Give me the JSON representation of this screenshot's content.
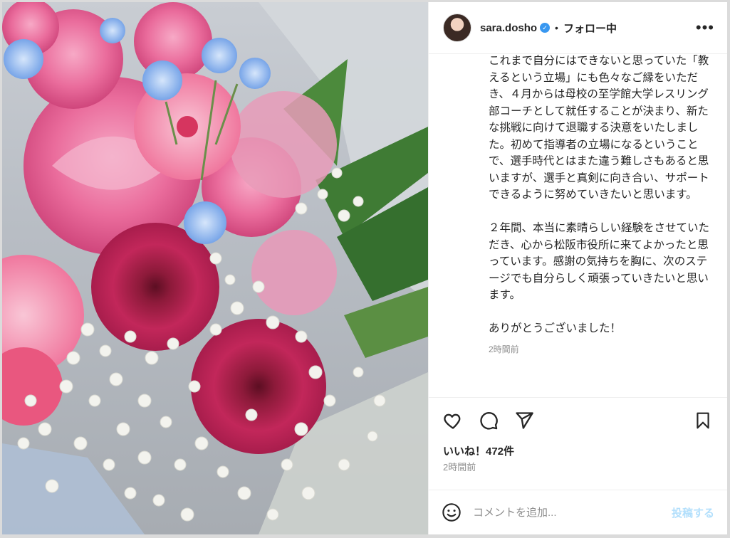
{
  "post": {
    "image_alt": "花束（ピンクのバラ、ガーベラ、青い花、かすみ草）",
    "author": {
      "username": "sara.dosho",
      "verified": true
    },
    "follow_state": "フォロー中",
    "separator": "•",
    "caption": "これまで自分にはできないと思っていた「教えるという立場」にも色々なご縁をいただき、４月からは母校の至学館大学レスリング部コーチとして就任することが決まり、新たな挑戦に向けて退職する決意をいたしました。初めて指導者の立場になるということで、選手時代とはまた違う難しさもあると思いますが、選手と真剣に向き合い、サポートできるように努めていきたいと思います。\n\n２年間、本当に素晴らしい経験をさせていただき、心から松阪市役所に来てよかったと思っています。感謝の気持ちを胸に、次のステージでも自分らしく頑張っていきたいと思います。\n\nありがとうございました！",
    "caption_time": "2時間前",
    "likes": "いいね！472件",
    "time": "2時間前"
  },
  "comment": {
    "placeholder": "コメントを追加...",
    "submit_label": "投稿する"
  },
  "icons": {
    "more": "more-options-icon",
    "like": "heart-icon",
    "comment": "comment-icon",
    "share": "paper-plane-icon",
    "save": "bookmark-icon",
    "emoji": "smiley-icon"
  },
  "colors": {
    "verified": "#3897f0",
    "post_button_disabled": "#b2dffc",
    "muted_text": "#8e8e8e"
  }
}
